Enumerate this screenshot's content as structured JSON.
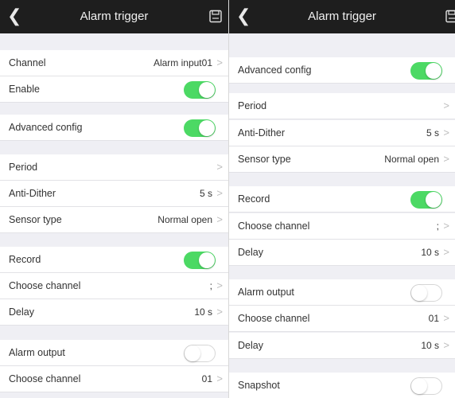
{
  "colors": {
    "titlebar": "#1e1e1e",
    "toggle_on": "#4cd964",
    "background": "#efeff4"
  },
  "left": {
    "title": "Alarm trigger",
    "rows": {
      "channel": {
        "label": "Channel",
        "value": "Alarm input01"
      },
      "enable": {
        "label": "Enable",
        "toggle": "on"
      },
      "advanced_config": {
        "label": "Advanced config",
        "toggle": "on"
      },
      "period": {
        "label": "Period"
      },
      "anti_dither": {
        "label": "Anti-Dither",
        "value": "5 s"
      },
      "sensor_type": {
        "label": "Sensor type",
        "value": "Normal open"
      },
      "record": {
        "label": "Record",
        "toggle": "on"
      },
      "choose_channel": {
        "label": "Choose channel",
        "value": ";"
      },
      "delay": {
        "label": "Delay",
        "value": "10 s"
      },
      "alarm_output": {
        "label": "Alarm output",
        "toggle": "off"
      },
      "choose_channel_2": {
        "label": "Choose channel",
        "value": "01"
      }
    }
  },
  "right": {
    "title": "Alarm trigger",
    "rows": {
      "advanced_config": {
        "label": "Advanced config",
        "toggle": "on"
      },
      "period": {
        "label": "Period"
      },
      "anti_dither": {
        "label": "Anti-Dither",
        "value": "5 s"
      },
      "sensor_type": {
        "label": "Sensor type",
        "value": "Normal open"
      },
      "record": {
        "label": "Record",
        "toggle": "on"
      },
      "choose_channel": {
        "label": "Choose channel",
        "value": ";"
      },
      "delay": {
        "label": "Delay",
        "value": "10 s"
      },
      "alarm_output": {
        "label": "Alarm output",
        "toggle": "off"
      },
      "choose_channel_2": {
        "label": "Choose channel",
        "value": "01"
      },
      "delay_2": {
        "label": "Delay",
        "value": "10 s"
      },
      "snapshot": {
        "label": "Snapshot",
        "toggle": "off"
      }
    }
  }
}
